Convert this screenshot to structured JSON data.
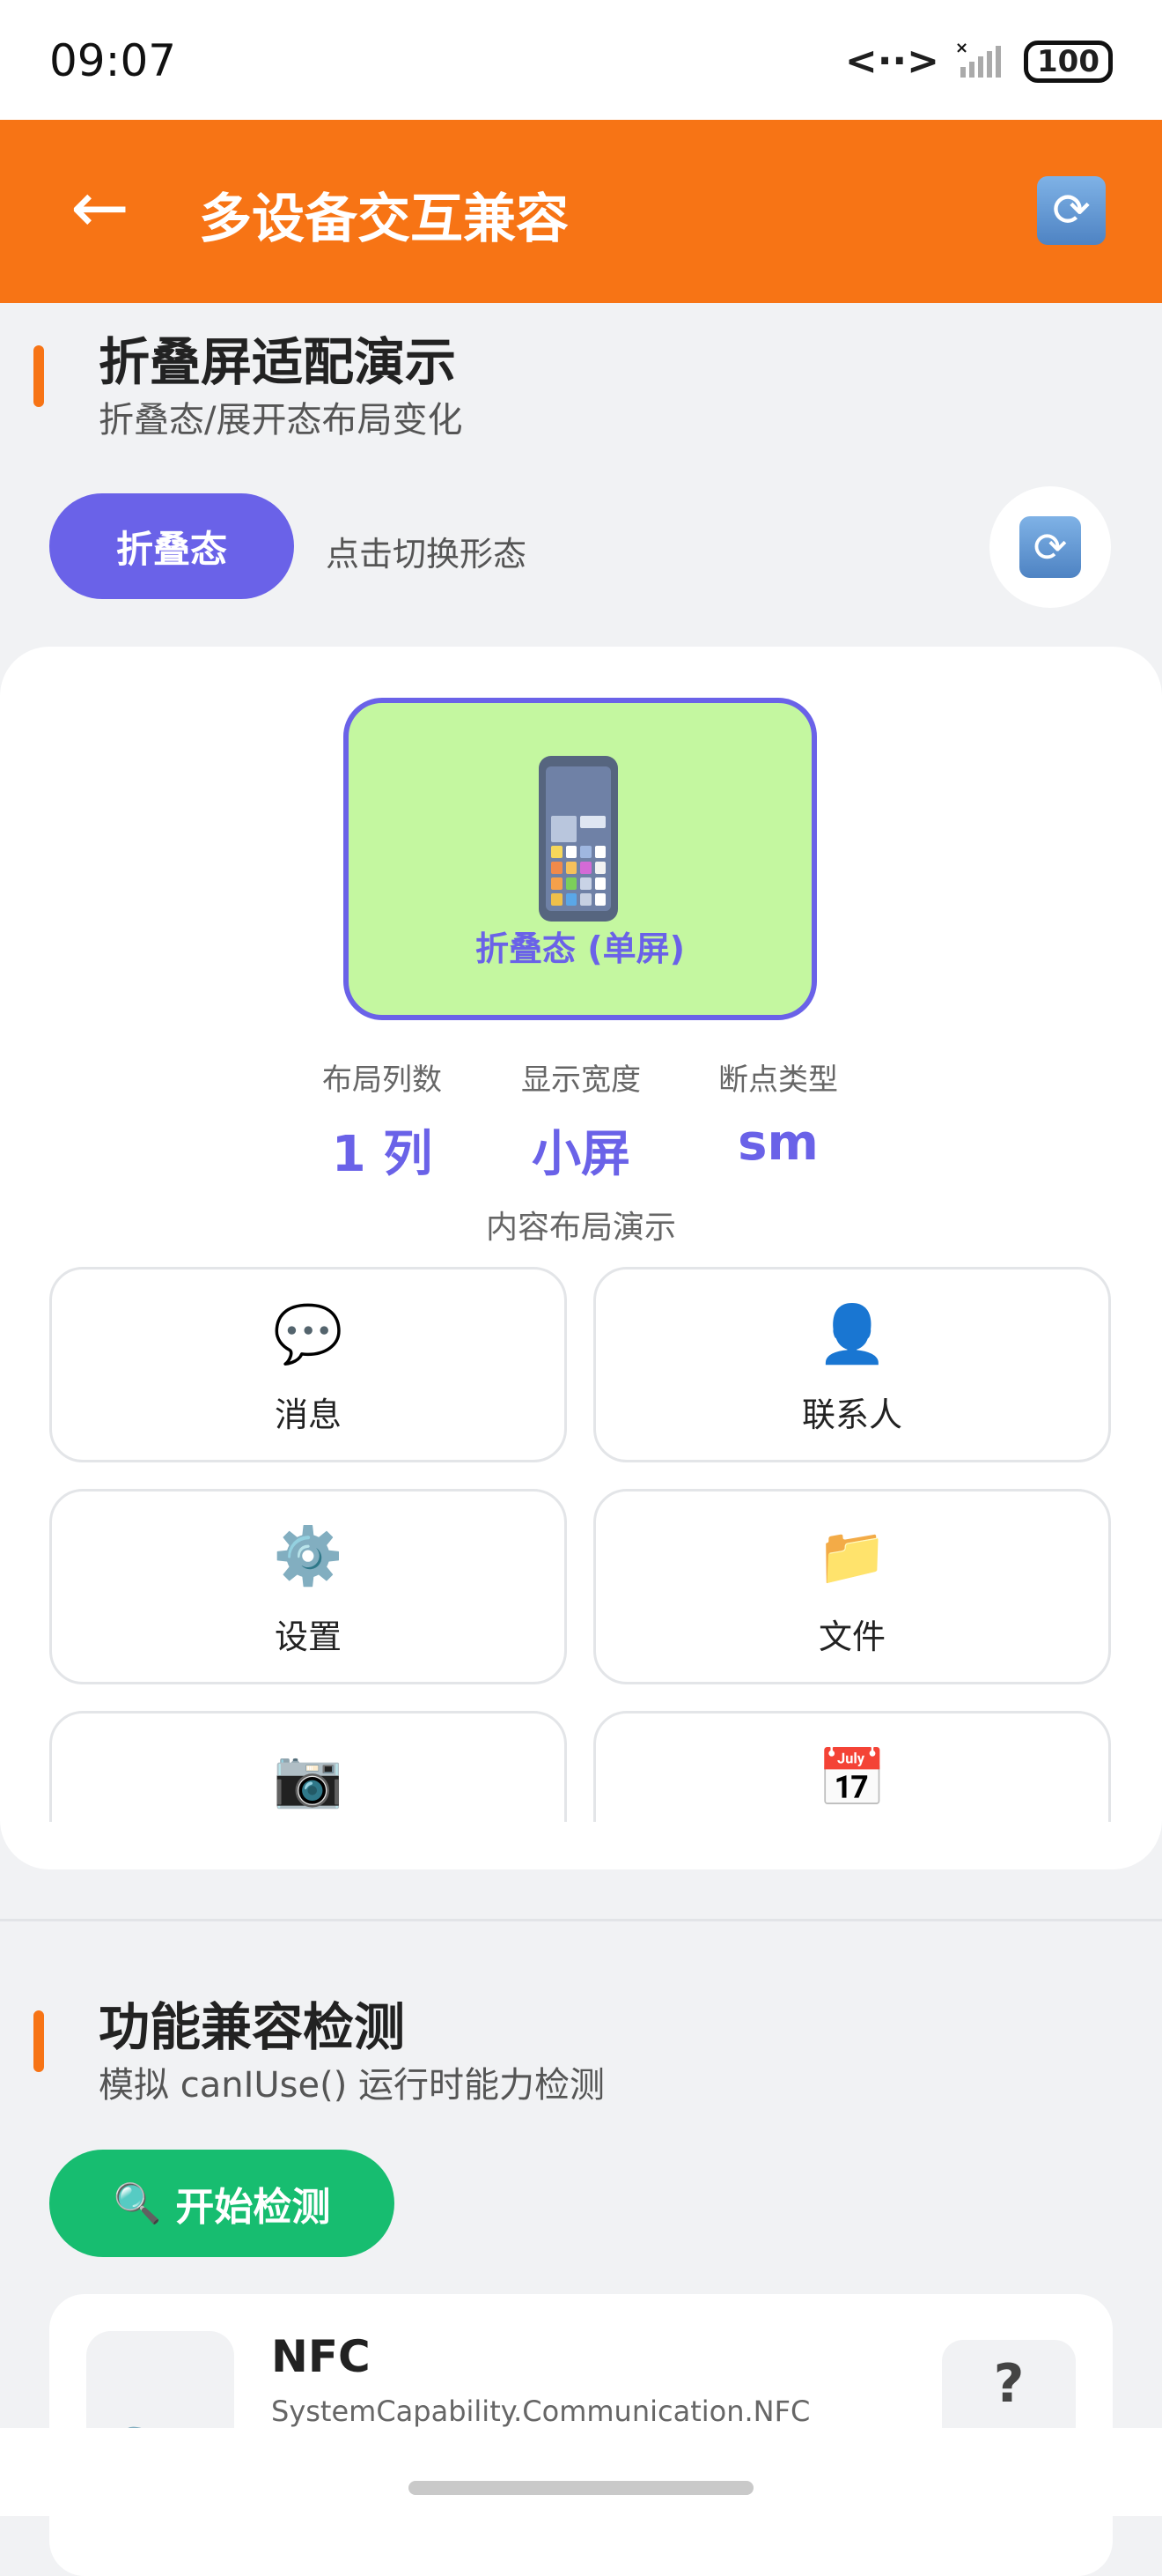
{
  "status_bar": {
    "time": "09:07",
    "battery": "100"
  },
  "header": {
    "title": "多设备交互兼容",
    "back_icon": "arrow-left-icon",
    "refresh_icon": "refresh-icon"
  },
  "fold_section": {
    "title": "折叠屏适配演示",
    "subtitle": "折叠态/展开态布局变化",
    "state_button": "折叠态",
    "toggle_hint": "点击切换形态",
    "device_label": "折叠态 (单屏)",
    "stats": [
      {
        "label": "布局列数",
        "value": "1 列"
      },
      {
        "label": "显示宽度",
        "value": "小屏"
      },
      {
        "label": "断点类型",
        "value": "sm"
      }
    ],
    "content_demo_label": "内容布局演示",
    "tiles": [
      {
        "icon": "💬",
        "label": "消息"
      },
      {
        "icon": "👤",
        "label": "联系人"
      },
      {
        "icon": "⚙️",
        "label": "设置"
      },
      {
        "icon": "📁",
        "label": "文件"
      },
      {
        "icon": "📷",
        "label": ""
      },
      {
        "icon": "📅",
        "label": ""
      }
    ]
  },
  "compat_section": {
    "title": "功能兼容检测",
    "subtitle": "模拟 canIUse() 运行时能力检测",
    "start_button": "开始检测",
    "start_icon": "🔍",
    "items": [
      {
        "name": "NFC",
        "capability": "SystemCapability.Communication.NFC",
        "status": "?",
        "icon": "📡"
      }
    ]
  },
  "colors": {
    "header": "#F77415",
    "accent": "#6A62E8",
    "device_bg": "#C4F7A0",
    "start_button": "#17BD70"
  }
}
